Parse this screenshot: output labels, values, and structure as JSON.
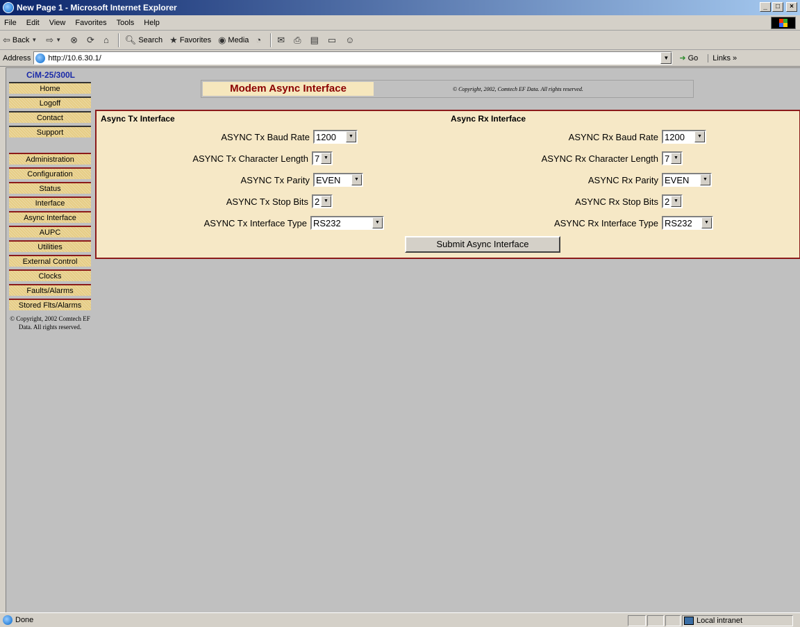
{
  "window": {
    "title": "New Page 1 - Microsoft Internet Explorer",
    "min": "_",
    "max": "□",
    "close": "×"
  },
  "menu": [
    "File",
    "Edit",
    "View",
    "Favorites",
    "Tools",
    "Help"
  ],
  "toolbar": {
    "back": "Back",
    "search": "Search",
    "favorites": "Favorites",
    "media": "Media"
  },
  "address": {
    "label": "Address",
    "url": "http://10.6.30.1/",
    "go": "Go",
    "links": "Links »"
  },
  "nav": {
    "brand": "CiM-25/300L",
    "top_items": [
      "Home",
      "Logoff",
      "Contact",
      "Support"
    ],
    "items": [
      "Administration",
      "Configuration",
      "Status",
      "Interface",
      "Async Interface",
      "AUPC",
      "Utilities",
      "External Control",
      "Clocks",
      "Faults/Alarms",
      "Stored Flts/Alarms"
    ],
    "copyright": "© Copyright, 2002 Comtech EF Data. All rights reserved."
  },
  "header": {
    "title": "Modem Async Interface",
    "copyright": "© Copyright, 2002, Comtech EF Data. All rights reserved."
  },
  "tx": {
    "title": "Async Tx Interface",
    "baud_label": "ASYNC Tx Baud Rate",
    "baud": "1200",
    "charlen_label": "ASYNC Tx Character Length",
    "charlen": "7",
    "parity_label": "ASYNC Tx Parity",
    "parity": "EVEN",
    "stop_label": "ASYNC Tx Stop Bits",
    "stop": "2",
    "iftype_label": "ASYNC Tx Interface Type",
    "iftype": "RS232"
  },
  "rx": {
    "title": "Async Rx Interface",
    "baud_label": "ASYNC Rx Baud Rate",
    "baud": "1200",
    "charlen_label": "ASYNC Rx Character Length",
    "charlen": "7",
    "parity_label": "ASYNC Rx Parity",
    "parity": "EVEN",
    "stop_label": "ASYNC Rx Stop Bits",
    "stop": "2",
    "iftype_label": "ASYNC Rx Interface Type",
    "iftype": "RS232"
  },
  "submit_label": "Submit Async Interface",
  "status": {
    "text": "Done",
    "zone": "Local intranet"
  }
}
